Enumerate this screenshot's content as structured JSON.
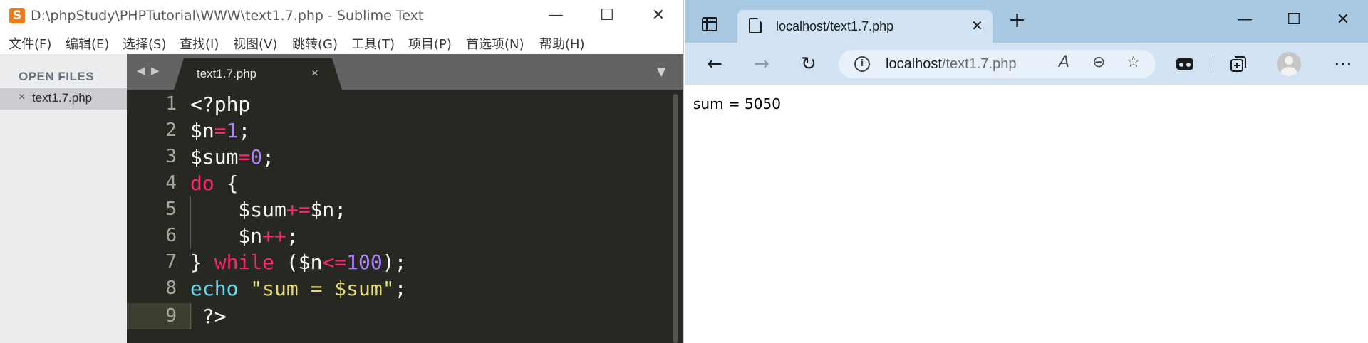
{
  "sublime": {
    "title": "D:\\phpStudy\\PHPTutorial\\WWW\\text1.7.php - Sublime Text",
    "logo_glyph": "S",
    "menu": [
      "文件(F)",
      "编辑(E)",
      "选择(S)",
      "查找(I)",
      "视图(V)",
      "跳转(G)",
      "工具(T)",
      "项目(P)",
      "首选项(N)",
      "帮助(H)"
    ],
    "sidebar": {
      "header": "OPEN FILES",
      "files": [
        {
          "name": "text1.7.php",
          "close": "×"
        }
      ]
    },
    "tab": {
      "label": "text1.7.php",
      "close": "×"
    },
    "line_numbers": [
      "1",
      "2",
      "3",
      "4",
      "5",
      "6",
      "7",
      "8",
      "9"
    ],
    "code": [
      [
        {
          "t": "<?php",
          "c": ""
        }
      ],
      [
        {
          "t": "$n",
          "c": ""
        },
        {
          "t": "=",
          "c": "kw"
        },
        {
          "t": "1",
          "c": "num"
        },
        {
          "t": ";",
          "c": ""
        }
      ],
      [
        {
          "t": "$sum",
          "c": ""
        },
        {
          "t": "=",
          "c": "kw"
        },
        {
          "t": "0",
          "c": "num"
        },
        {
          "t": ";",
          "c": ""
        }
      ],
      [
        {
          "t": "do",
          "c": "kw"
        },
        {
          "t": " {",
          "c": ""
        }
      ],
      [
        {
          "t": "    $sum",
          "c": ""
        },
        {
          "t": "+=",
          "c": "kw"
        },
        {
          "t": "$n;",
          "c": ""
        }
      ],
      [
        {
          "t": "    $n",
          "c": ""
        },
        {
          "t": "++",
          "c": "kw"
        },
        {
          "t": ";",
          "c": ""
        }
      ],
      [
        {
          "t": "} ",
          "c": ""
        },
        {
          "t": "while",
          "c": "kw"
        },
        {
          "t": " ($n",
          "c": ""
        },
        {
          "t": "<=",
          "c": "kw"
        },
        {
          "t": "100",
          "c": "num"
        },
        {
          "t": ");",
          "c": ""
        }
      ],
      [
        {
          "t": "echo",
          "c": "fn"
        },
        {
          "t": " ",
          "c": ""
        },
        {
          "t": "\"sum = $sum\"",
          "c": "str"
        },
        {
          "t": ";",
          "c": ""
        }
      ],
      [
        {
          "t": " ?>",
          "c": ""
        }
      ]
    ],
    "colors": {
      "editor_bg": "#272822",
      "keyword": "#f92672",
      "number": "#ae81ff",
      "function": "#66d9ef",
      "string": "#e6db74"
    },
    "window_controls": {
      "minimize": "—",
      "maximize": "☐",
      "close": "✕"
    }
  },
  "edge": {
    "tab": {
      "title": "localhost/text1.7.php",
      "close": "✕"
    },
    "new_tab": "+",
    "window_controls": {
      "minimize": "—",
      "maximize": "☐",
      "close": "✕"
    },
    "toolbar": {
      "back": "←",
      "forward": "→",
      "refresh": "↻",
      "more": "⋯"
    },
    "address": {
      "host": "localhost",
      "path": "/text1.7.php",
      "info_glyph": "i"
    },
    "address_icons": {
      "read_aloud": "A",
      "zoom": "⊖",
      "favorite": "☆"
    },
    "page_output": "sum = 5050"
  }
}
